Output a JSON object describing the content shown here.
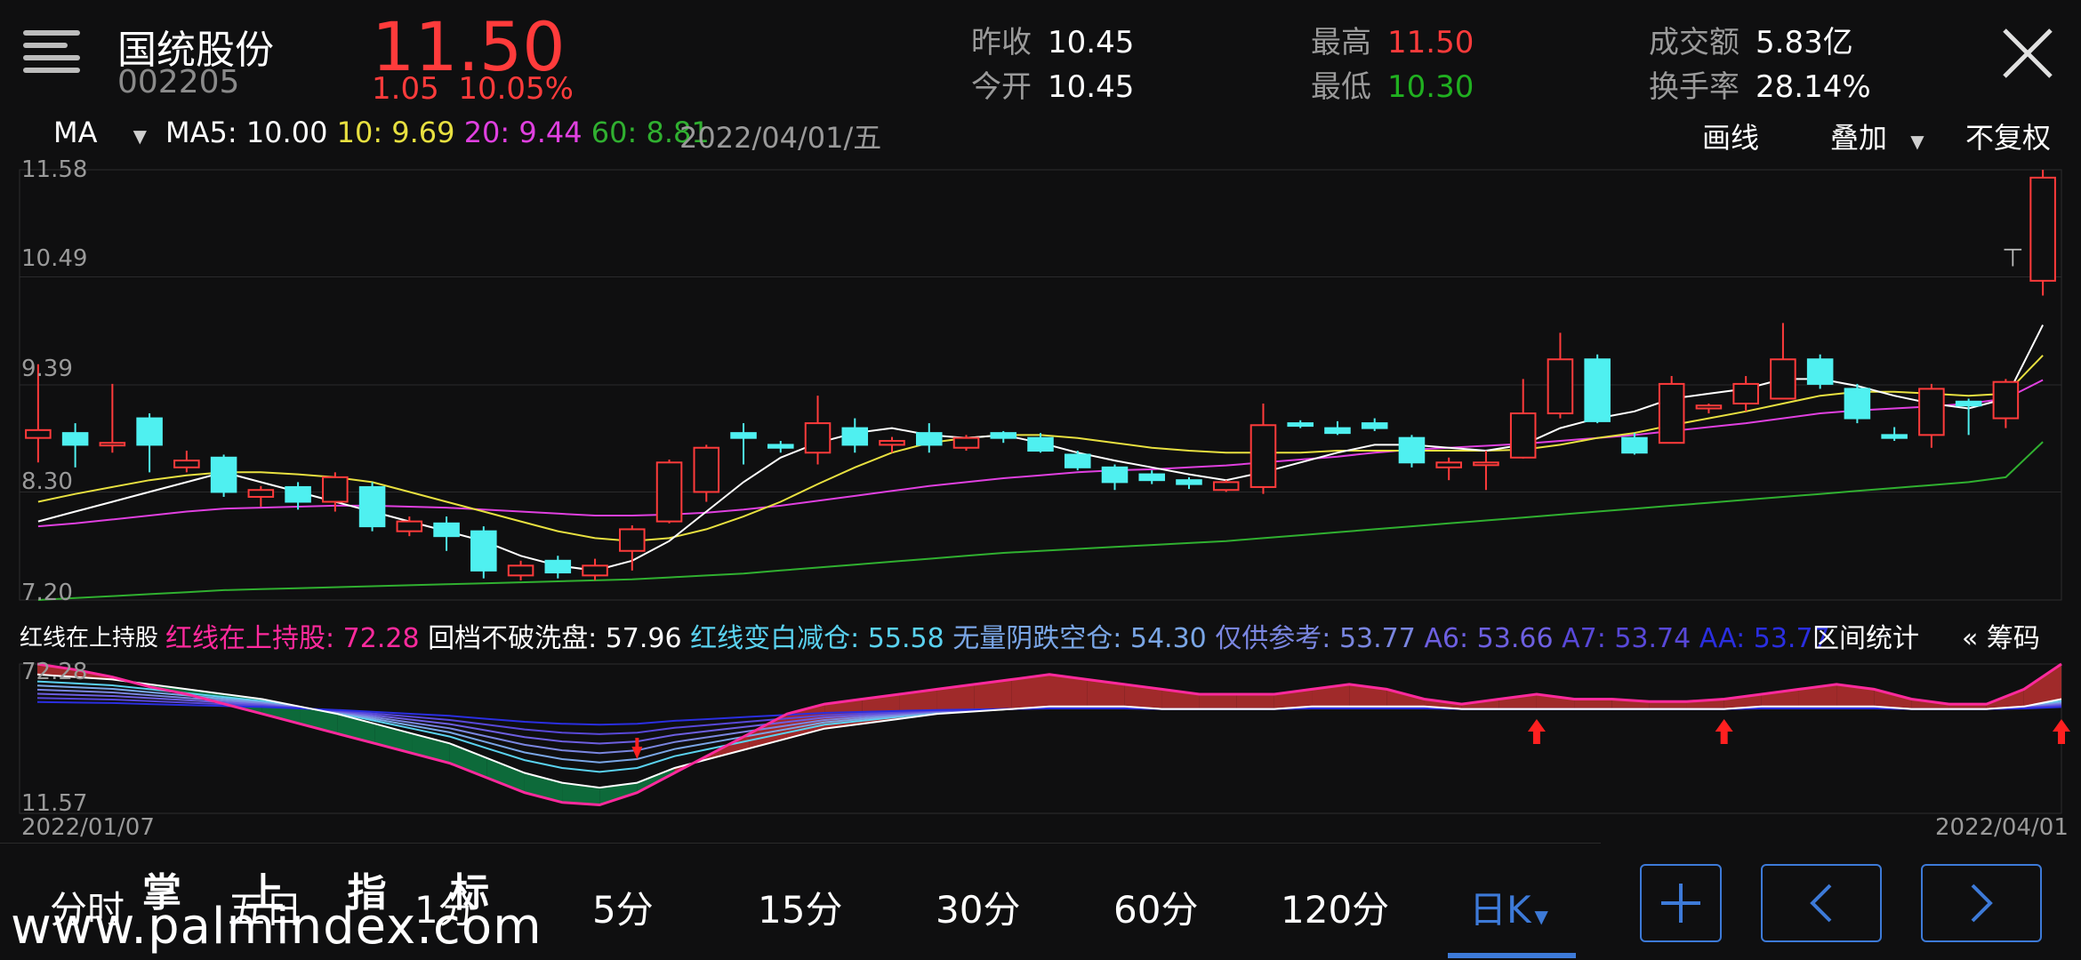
{
  "header": {
    "stock_name": "国统股份",
    "stock_code": "002205",
    "price": "11.50",
    "change_amount": "1.05",
    "change_percent": "10.05%",
    "prev_close_label": "昨收",
    "prev_close": "10.45",
    "open_label": "今开",
    "open": "10.45",
    "high_label": "最高",
    "high": "11.50",
    "low_label": "最低",
    "low": "10.30",
    "turnover_amount_label": "成交额",
    "turnover_amount": "5.83亿",
    "turnover_rate_label": "换手率",
    "turnover_rate": "28.14%"
  },
  "ma_bar": {
    "selector": "MA",
    "ma5": "MA5: 10.00",
    "ma10": "10: 9.69",
    "ma20": "20: 9.44",
    "ma60": "60: 8.81",
    "date": "2022/04/01/五"
  },
  "toolbar": {
    "draw": "画线",
    "overlay": "叠加",
    "adjust": "不复权"
  },
  "price_axis": [
    "11.58",
    "10.49",
    "9.39",
    "8.30",
    "7.20"
  ],
  "indicator": {
    "name": "红线在上持股",
    "v1": "红线在上持股: 72.28",
    "v2": "回档不破洗盘: 57.96",
    "v3": "红线变白减仓: 55.58",
    "v4": "无量阴跌空仓: 54.30",
    "v5": "仅供参考: 53.77",
    "v6": "A6: 53.66",
    "v7": "A7: 53.74",
    "v8": "AA: 53.77",
    "range_stats": "区间统计",
    "chips": "« 筹码",
    "axis_top": "72.28",
    "axis_bottom": "11.57"
  },
  "date_range": {
    "start": "2022/01/07",
    "end": "2022/04/01"
  },
  "tabs": [
    "分时",
    "五日",
    "1分",
    "5分",
    "15分",
    "30分",
    "60分",
    "120分",
    "日K"
  ],
  "active_tab": "日K",
  "watermark": {
    "cn": "掌 上 指 标",
    "url": "www.palmindex.com"
  },
  "colors": {
    "up": "#ff3b3b",
    "down": "#4ff0f0",
    "ma5": "#ffffff",
    "ma10": "#e8e040",
    "ma20": "#e040e0",
    "ma60": "#30b030",
    "accent": "#3d7ad8"
  },
  "chart_data": {
    "type": "candlestick",
    "x_start": "2022/01/07",
    "x_end": "2022/04/01",
    "ylim": [
      7.2,
      11.58
    ],
    "candles": [
      [
        8.85,
        8.93,
        9.6,
        8.6
      ],
      [
        8.9,
        8.78,
        9.0,
        8.55
      ],
      [
        8.8,
        8.8,
        9.4,
        8.7
      ],
      [
        9.05,
        8.78,
        9.1,
        8.5
      ],
      [
        8.55,
        8.62,
        8.72,
        8.5
      ],
      [
        8.65,
        8.3,
        8.68,
        8.25
      ],
      [
        8.25,
        8.32,
        8.36,
        8.15
      ],
      [
        8.35,
        8.2,
        8.4,
        8.12
      ],
      [
        8.2,
        8.45,
        8.5,
        8.1
      ],
      [
        8.35,
        7.95,
        8.4,
        7.9
      ],
      [
        7.9,
        8.0,
        8.05,
        7.85
      ],
      [
        7.98,
        7.85,
        8.05,
        7.7
      ],
      [
        7.9,
        7.5,
        7.95,
        7.42
      ],
      [
        7.45,
        7.55,
        7.6,
        7.4
      ],
      [
        7.6,
        7.48,
        7.65,
        7.42
      ],
      [
        7.45,
        7.55,
        7.62,
        7.4
      ],
      [
        7.7,
        7.92,
        7.96,
        7.5
      ],
      [
        8.0,
        8.6,
        8.63,
        7.98
      ],
      [
        8.3,
        8.75,
        8.78,
        8.2
      ],
      [
        8.9,
        8.85,
        9.0,
        8.58
      ],
      [
        8.78,
        8.75,
        8.82,
        8.7
      ],
      [
        8.7,
        9.0,
        9.28,
        8.58
      ],
      [
        8.95,
        8.78,
        9.05,
        8.7
      ],
      [
        8.78,
        8.82,
        8.86,
        8.7
      ],
      [
        8.9,
        8.78,
        9.0,
        8.7
      ],
      [
        8.75,
        8.85,
        8.88,
        8.72
      ],
      [
        8.9,
        8.85,
        8.92,
        8.8
      ],
      [
        8.85,
        8.72,
        8.9,
        8.7
      ],
      [
        8.68,
        8.55,
        8.72,
        8.52
      ],
      [
        8.55,
        8.4,
        8.58,
        8.32
      ],
      [
        8.48,
        8.42,
        8.52,
        8.38
      ],
      [
        8.42,
        8.38,
        8.45,
        8.33
      ],
      [
        8.32,
        8.4,
        8.42,
        8.3
      ],
      [
        8.35,
        8.98,
        9.2,
        8.28
      ],
      [
        9.0,
        8.98,
        9.03,
        8.95
      ],
      [
        8.95,
        8.9,
        9.02,
        8.88
      ],
      [
        9.0,
        8.95,
        9.05,
        8.92
      ],
      [
        8.85,
        8.6,
        8.88,
        8.55
      ],
      [
        8.55,
        8.6,
        8.65,
        8.42
      ],
      [
        8.6,
        8.6,
        8.72,
        8.32
      ],
      [
        8.65,
        9.1,
        9.45,
        8.64
      ],
      [
        9.1,
        9.65,
        9.92,
        9.05
      ],
      [
        9.65,
        9.02,
        9.7,
        9.0
      ],
      [
        8.85,
        8.7,
        8.9,
        8.68
      ],
      [
        8.8,
        9.4,
        9.48,
        8.82
      ],
      [
        9.15,
        9.18,
        9.2,
        9.1
      ],
      [
        9.2,
        9.4,
        9.48,
        9.12
      ],
      [
        9.25,
        9.65,
        10.02,
        9.25
      ],
      [
        9.65,
        9.4,
        9.7,
        9.35
      ],
      [
        9.35,
        9.05,
        9.4,
        9.0
      ],
      [
        8.88,
        8.85,
        8.96,
        8.82
      ],
      [
        8.88,
        9.35,
        9.4,
        8.75
      ],
      [
        9.22,
        9.18,
        9.25,
        8.88
      ],
      [
        9.05,
        9.42,
        9.45,
        8.95
      ],
      [
        10.45,
        11.5,
        11.58,
        10.3
      ]
    ],
    "ma5": [
      8.0,
      8.1,
      8.2,
      8.3,
      8.4,
      8.5,
      8.4,
      8.3,
      8.2,
      8.1,
      8.0,
      7.9,
      7.8,
      7.65,
      7.55,
      7.5,
      7.6,
      7.8,
      8.1,
      8.4,
      8.65,
      8.8,
      8.9,
      8.95,
      8.88,
      8.85,
      8.88,
      8.8,
      8.7,
      8.62,
      8.55,
      8.48,
      8.42,
      8.5,
      8.6,
      8.7,
      8.78,
      8.78,
      8.75,
      8.72,
      8.78,
      8.95,
      9.05,
      9.12,
      9.25,
      9.3,
      9.35,
      9.45,
      9.45,
      9.38,
      9.28,
      9.2,
      9.15,
      9.25,
      10.0
    ],
    "ma10": [
      8.2,
      8.28,
      8.35,
      8.42,
      8.47,
      8.5,
      8.5,
      8.48,
      8.45,
      8.4,
      8.3,
      8.2,
      8.1,
      8.0,
      7.9,
      7.83,
      7.8,
      7.83,
      7.92,
      8.05,
      8.2,
      8.38,
      8.55,
      8.7,
      8.8,
      8.85,
      8.88,
      8.88,
      8.85,
      8.8,
      8.75,
      8.72,
      8.7,
      8.7,
      8.7,
      8.72,
      8.72,
      8.72,
      8.72,
      8.72,
      8.73,
      8.78,
      8.85,
      8.9,
      8.98,
      9.05,
      9.12,
      9.2,
      9.28,
      9.32,
      9.32,
      9.3,
      9.28,
      9.3,
      9.69
    ],
    "ma20": [
      7.95,
      7.98,
      8.02,
      8.06,
      8.1,
      8.13,
      8.14,
      8.15,
      8.16,
      8.16,
      8.15,
      8.14,
      8.12,
      8.1,
      8.08,
      8.06,
      8.06,
      8.07,
      8.09,
      8.12,
      8.16,
      8.21,
      8.26,
      8.31,
      8.36,
      8.4,
      8.44,
      8.47,
      8.5,
      8.52,
      8.53,
      8.55,
      8.57,
      8.6,
      8.63,
      8.66,
      8.7,
      8.73,
      8.75,
      8.77,
      8.79,
      8.82,
      8.85,
      8.88,
      8.92,
      8.96,
      9.0,
      9.05,
      9.1,
      9.13,
      9.15,
      9.17,
      9.2,
      9.25,
      9.44
    ],
    "ma60": [
      7.2,
      7.22,
      7.24,
      7.26,
      7.28,
      7.3,
      7.31,
      7.32,
      7.33,
      7.34,
      7.35,
      7.36,
      7.37,
      7.38,
      7.39,
      7.4,
      7.41,
      7.43,
      7.45,
      7.47,
      7.5,
      7.53,
      7.56,
      7.59,
      7.62,
      7.65,
      7.68,
      7.7,
      7.72,
      7.74,
      7.76,
      7.78,
      7.8,
      7.83,
      7.86,
      7.89,
      7.92,
      7.95,
      7.98,
      8.01,
      8.04,
      8.07,
      8.1,
      8.13,
      8.16,
      8.19,
      8.22,
      8.25,
      8.28,
      8.31,
      8.34,
      8.37,
      8.4,
      8.45,
      8.81
    ],
    "indicator_red_line": [
      72.28,
      70,
      67,
      63,
      60,
      56,
      52,
      48,
      44,
      40,
      36,
      32,
      26,
      20,
      16,
      15,
      20,
      28,
      36,
      44,
      52,
      56,
      58,
      60,
      62,
      64,
      66,
      68,
      66,
      64,
      62,
      60,
      60,
      60,
      62,
      64,
      62,
      58,
      56,
      58,
      60,
      58,
      58,
      57,
      57,
      58,
      60,
      62,
      64,
      62,
      58,
      56,
      56,
      62,
      72.28
    ],
    "indicator_white_line": [
      68,
      67,
      66,
      64,
      62,
      60,
      58,
      55,
      52,
      48,
      44,
      40,
      34,
      28,
      24,
      22,
      24,
      30,
      34,
      38,
      42,
      46,
      48,
      50,
      52,
      53,
      54,
      55,
      55,
      55,
      54,
      54,
      54,
      54,
      55,
      55,
      55,
      55,
      54,
      54,
      54,
      54,
      54,
      54,
      54,
      54,
      55,
      55,
      55,
      55,
      54,
      54,
      54,
      55,
      58
    ]
  }
}
